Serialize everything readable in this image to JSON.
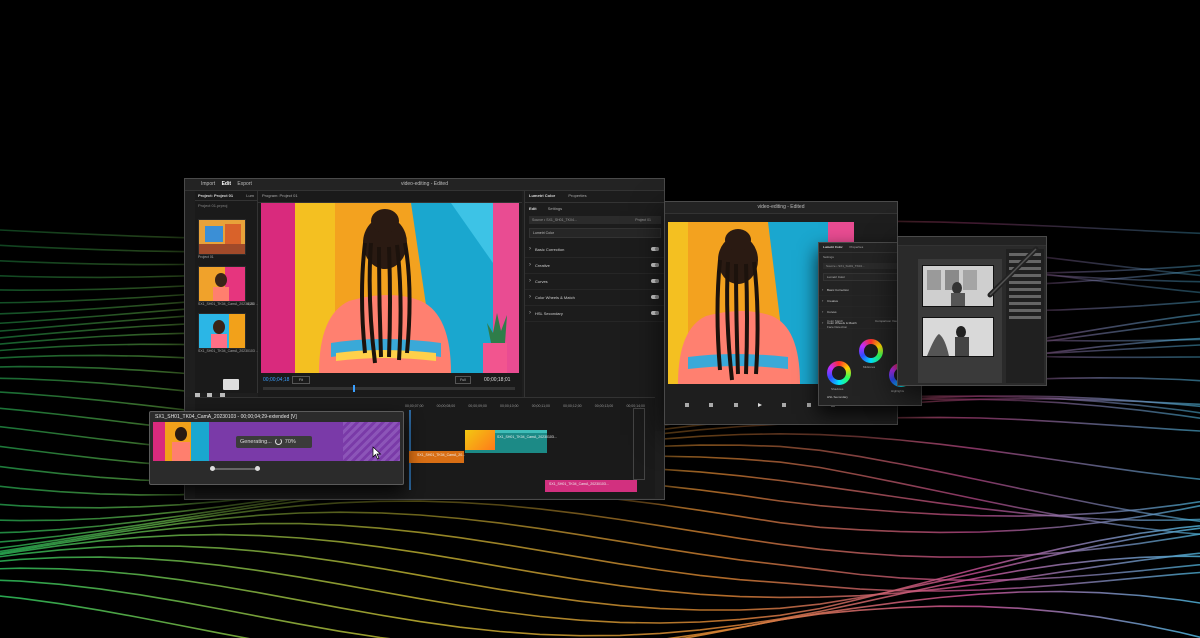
{
  "main_window": {
    "title": "video-editing - Edited",
    "workspace_tabs": [
      "Import",
      "Edit",
      "Export"
    ],
    "active_workspace": "Edit",
    "project_panel": {
      "tabs": [
        "Project: Project 01",
        "Lum"
      ],
      "bin": "Project 01.prproj",
      "clips": [
        {
          "name": "Project 01",
          "duration": ""
        },
        {
          "name": "SX1_SH01_TK04_CamA_20230103 ...",
          "duration": "4;20"
        },
        {
          "name": "SX1_SH01_TK04_CamA_20230103 ...",
          "duration": ""
        }
      ]
    },
    "program_monitor": {
      "tab": "Program: Project 01",
      "timecode_current": "00;00;04;18",
      "fit": "Fit",
      "quality": "Full",
      "timecode_duration": "00;00;18;01"
    },
    "lumetri": {
      "tabs": [
        "Lumetri Color",
        "Properties"
      ],
      "subtabs": [
        "Edit",
        "Settings"
      ],
      "source": "Source • SX1_SH01_TK04...",
      "target": "Project 01",
      "master": "Lumetri Color",
      "sections": [
        "Basic Correction",
        "Creative",
        "Curves",
        "Color Wheels & Match",
        "HSL Secondary"
      ]
    },
    "timeline": {
      "ruler": [
        "00;00;07;00",
        "00;00;08;00",
        "00;00;09;00",
        "00;00;10;00",
        "00;00;11;00",
        "00;00;12;00",
        "00;00;13;00",
        "00;00;14;00"
      ],
      "clip_green": "SX1_SH01_TK04_CamA_20230103...",
      "clip_orange": "SX1_SH01_TK04_CamA_20...",
      "clip_pink": "SX1_SH01_TK04_CamA_20230103..."
    }
  },
  "generative_extend": {
    "clip_label": "SX1_SH01_TK04_CamA_20230103 - 00;00;04;29-extended [V]",
    "status": "Generating...",
    "progress_label": "70%",
    "progress": 0.7
  },
  "second_window": {
    "title": "video-editing - Edited"
  },
  "lumetri_popup": {
    "tabs": [
      "Lumetri Color",
      "Properties"
    ],
    "subtab": "Settings",
    "source": "Source • SX1_SH01_TK04...",
    "master": "Lumetri Color",
    "sections": [
      "Basic Correction",
      "Creative",
      "Curves",
      "Color Wheels & Match",
      "HSL Secondary"
    ],
    "match_label": "Color Match",
    "compare_label": "Comparison View",
    "face_label": "Face Detection",
    "wheel_labels": [
      "Midtones",
      "Shadows",
      "Highlights"
    ],
    "bottom_section": "HSL Secondary"
  },
  "colors": {
    "accent_blue": "#3aa0ff",
    "clip_green": "#1c8a86",
    "clip_orange": "#d86e14",
    "clip_pink": "#d2307f",
    "gen_purple": "#7a3aa8"
  }
}
